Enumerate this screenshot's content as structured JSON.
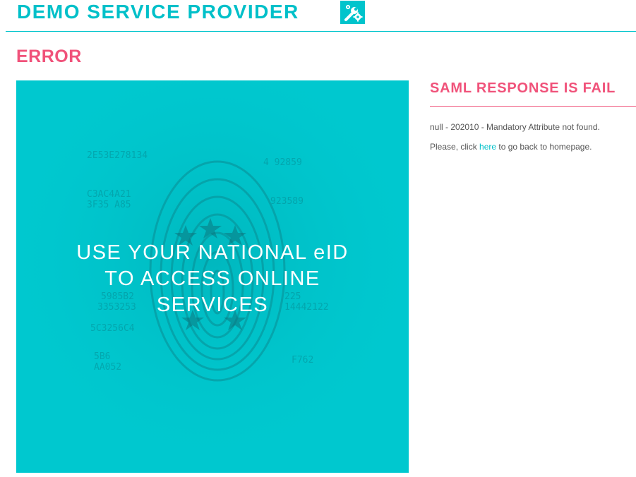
{
  "header": {
    "brand": "DEMO SERVICE PROVIDER",
    "brand_icon": "tools-icon"
  },
  "page": {
    "title": "ERROR"
  },
  "hero": {
    "line1": "USE YOUR NATIONAL eID",
    "line2": "TO ACCESS ONLINE",
    "line3": "SERVICES",
    "image": "fingerprint-image"
  },
  "panel": {
    "title": "SAML RESPONSE IS FAIL",
    "error_message": "null - 202010 - Mandatory Attribute not found.",
    "back_prefix": "Please, click ",
    "back_link": "here",
    "back_suffix": " to go back to homepage."
  },
  "colors": {
    "teal": "#00c4cc",
    "pink": "#f0527a"
  }
}
